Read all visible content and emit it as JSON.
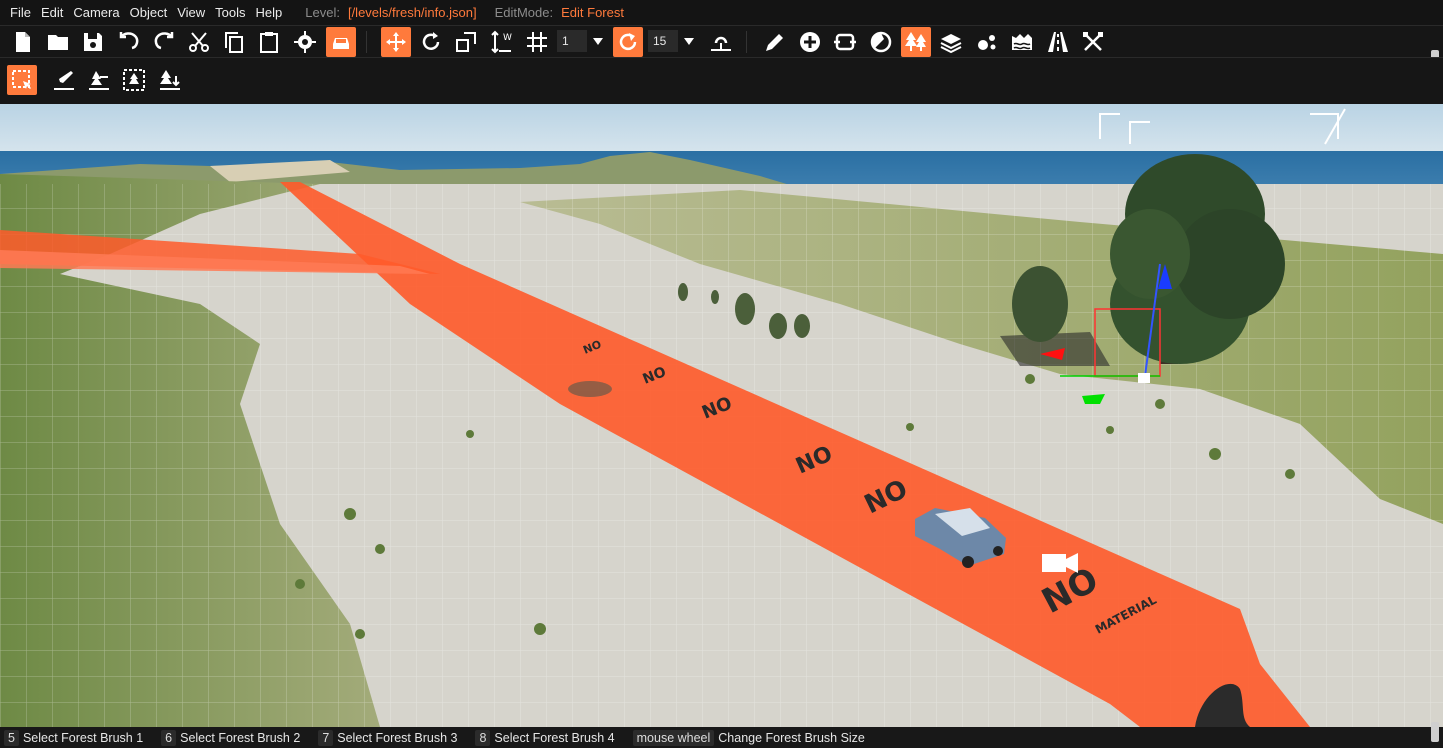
{
  "menu": {
    "items": [
      "File",
      "Edit",
      "Camera",
      "Object",
      "View",
      "Tools",
      "Help"
    ],
    "level_label": "Level:",
    "level_value": "[/levels/fresh/info.json]",
    "editmode_label": "EditMode:",
    "editmode_value": "Edit Forest"
  },
  "toolbar": {
    "snap_value": "1",
    "rotation_snap_value": "15",
    "icons": [
      "new-file-icon",
      "open-folder-icon",
      "save-icon",
      "undo-icon",
      "redo-icon",
      "cut-icon",
      "copy-icon",
      "paste-icon",
      "settings-gear-icon",
      "vehicle-icon",
      "translate-icon",
      "rotate-icon",
      "scale-icon",
      "world-axis-icon",
      "grid-snap-icon",
      "rotation-snap-icon",
      "terrain-snap-icon",
      "pencil-icon",
      "add-circle-icon",
      "decal-road-icon",
      "paint-icon",
      "forest-icon",
      "layers-icon",
      "particles-icon",
      "river-icon",
      "road-icon",
      "tools-icon"
    ]
  },
  "forest_toolbar": {
    "icons": [
      "select-tool-icon",
      "paint-brush-icon",
      "erase-tree-icon",
      "erase-selection-icon",
      "tree-align-icon"
    ]
  },
  "viewport": {
    "no_material_label_main": "NO",
    "no_material_label_sub": "MATERIAL"
  },
  "hints": [
    {
      "key": "5",
      "label": "Select Forest Brush 1"
    },
    {
      "key": "6",
      "label": "Select Forest Brush 2"
    },
    {
      "key": "7",
      "label": "Select Forest Brush 3"
    },
    {
      "key": "8",
      "label": "Select Forest Brush 4"
    },
    {
      "key": "mouse wheel",
      "label": "Change Forest Brush Size"
    }
  ],
  "colors": {
    "accent": "#ff7a3c",
    "road": "#ff5a2a",
    "sky": "#c9dde9",
    "sea": "#2a6fa3",
    "grass": "#8a9a5a"
  }
}
